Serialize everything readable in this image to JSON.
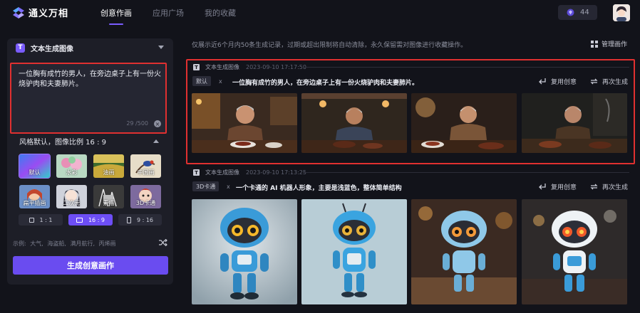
{
  "app": {
    "name": "通义万相"
  },
  "nav": {
    "items": [
      "创意作画",
      "应用广场",
      "我的收藏"
    ],
    "active": 0
  },
  "credits": {
    "value": "44"
  },
  "panel": {
    "title": "文本生成图像",
    "prompt": "一位胸有成竹的男人，在旁边桌子上有一份火烧驴肉和夫妻肺片。",
    "char_count": "29 /500",
    "style_summary": "风格默认，图像比例 16 : 9",
    "styles": [
      {
        "label": "默认",
        "selected": true
      },
      {
        "label": "水彩",
        "selected": false
      },
      {
        "label": "油画",
        "selected": false
      },
      {
        "label": "中国画",
        "selected": false
      },
      {
        "label": "扁平插画",
        "selected": false
      },
      {
        "label": "二次元",
        "selected": false
      },
      {
        "label": "素描",
        "selected": false
      },
      {
        "label": "3D卡通",
        "selected": false
      }
    ],
    "ratios": [
      {
        "label": "1 : 1",
        "selected": false
      },
      {
        "label": "16 : 9",
        "selected": true
      },
      {
        "label": "9 : 16",
        "selected": false
      }
    ],
    "examples_label": "示例:",
    "examples": [
      "大气",
      "海盗船",
      "满月航行",
      "丙烯画"
    ],
    "generate_label": "生成创意画作"
  },
  "main": {
    "notice": "仅展示近6个月内50条生成记录，过期或超出限制将自动清除，永久保留需对图像进行收藏操作。",
    "manage_label": "管理画作",
    "records": [
      {
        "type_label": "文本生成图像",
        "date": "2023-09-10 17:17:50",
        "tag": "默认",
        "prompt": "一位胸有成竹的男人，在旁边桌子上有一份火烧驴肉和夫妻肺片。",
        "reuse_label": "复用创意",
        "regen_label": "再次生成"
      },
      {
        "type_label": "文本生成图像",
        "date": "2023-09-10 17:13:25",
        "tag": "3D卡通",
        "prompt": "一个卡通的 AI 机器人形象，主要是浅蓝色，整体简单结构",
        "reuse_label": "复用创意",
        "regen_label": "再次生成"
      }
    ]
  },
  "colors": {
    "accent": "#6a4cf0",
    "highlight": "#e03030",
    "background": "#12131a",
    "panel": "#1d1e27"
  }
}
